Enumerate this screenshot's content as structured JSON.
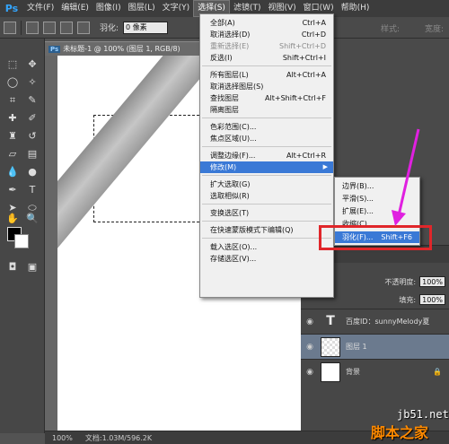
{
  "app": {
    "logo": "Ps"
  },
  "menubar": {
    "items": [
      "文件(F)",
      "编辑(E)",
      "图像(I)",
      "图层(L)",
      "文字(Y)",
      "选择(S)",
      "滤镜(T)",
      "视图(V)",
      "窗口(W)",
      "帮助(H)"
    ]
  },
  "optionsbar": {
    "feather_label": "羽化:",
    "feather_value": "0 像素",
    "right_label": "宽度:",
    "right_label2": "样式:"
  },
  "document": {
    "tab_title": "未标题-1 @ 100% (图层 1, RGB/8)"
  },
  "statusbar": {
    "zoom": "100%",
    "doc_size": "文档:1.03M/596.2K"
  },
  "select_menu": {
    "items": [
      {
        "label": "全部(A)",
        "shortcut": "Ctrl+A",
        "disabled": false
      },
      {
        "label": "取消选择(D)",
        "shortcut": "Ctrl+D",
        "disabled": false
      },
      {
        "label": "重新选择(E)",
        "shortcut": "Shift+Ctrl+D",
        "disabled": true
      },
      {
        "label": "反选(I)",
        "shortcut": "Shift+Ctrl+I",
        "disabled": false
      },
      {
        "label": "所有图层(L)",
        "shortcut": "Alt+Ctrl+A",
        "disabled": false
      },
      {
        "label": "取消选择图层(S)",
        "shortcut": "",
        "disabled": false
      },
      {
        "label": "查找图层",
        "shortcut": "Alt+Shift+Ctrl+F",
        "disabled": false
      },
      {
        "label": "隔离图层",
        "shortcut": "",
        "disabled": false
      },
      {
        "label": "色彩范围(C)...",
        "shortcut": "",
        "disabled": false
      },
      {
        "label": "焦点区域(U)...",
        "shortcut": "",
        "disabled": false
      },
      {
        "label": "调整边缘(F)...",
        "shortcut": "Alt+Ctrl+R",
        "disabled": false
      },
      {
        "label": "修改(M)",
        "shortcut": "",
        "disabled": false
      },
      {
        "label": "扩大选取(G)",
        "shortcut": "",
        "disabled": false
      },
      {
        "label": "选取相似(R)",
        "shortcut": "",
        "disabled": false
      },
      {
        "label": "变换选区(T)",
        "shortcut": "",
        "disabled": false
      },
      {
        "label": "在快速蒙版模式下编辑(Q)",
        "shortcut": "",
        "disabled": false
      },
      {
        "label": "载入选区(O)...",
        "shortcut": "",
        "disabled": false
      },
      {
        "label": "存储选区(V)...",
        "shortcut": "",
        "disabled": false
      }
    ]
  },
  "modify_submenu": {
    "items": [
      {
        "label": "边界(B)...",
        "shortcut": ""
      },
      {
        "label": "平滑(S)...",
        "shortcut": ""
      },
      {
        "label": "扩展(E)...",
        "shortcut": ""
      },
      {
        "label": "收缩(C)...",
        "shortcut": ""
      },
      {
        "label": "羽化(F)...",
        "shortcut": "Shift+F6"
      }
    ]
  },
  "layers_panel": {
    "opacity_label": "不透明度:",
    "opacity_value": "100%",
    "fill_label": "填充:",
    "fill_value": "100%",
    "layers": [
      {
        "name": "百度ID：sunnyMelody夏",
        "type": "text"
      },
      {
        "name": "图层 1",
        "type": "pixel",
        "selected": true
      },
      {
        "name": "背景",
        "type": "background"
      }
    ]
  },
  "watermark": {
    "site": "jb51.net",
    "text": "脚本之家"
  },
  "colors": {
    "highlight": "#3a79d6",
    "annotation_box": "#e0262a",
    "annotation_arrow": "#e020e0"
  }
}
